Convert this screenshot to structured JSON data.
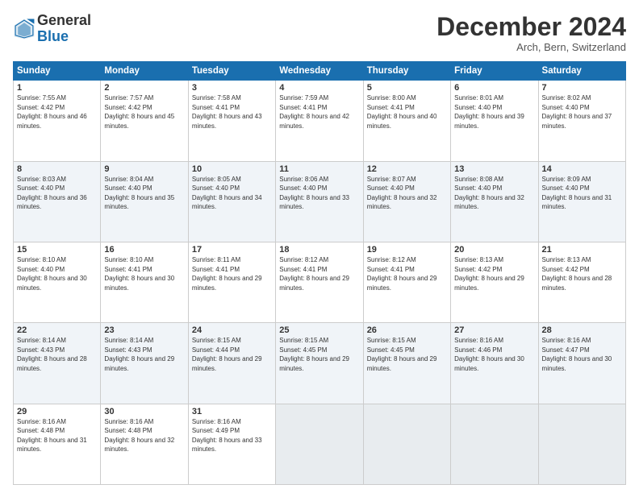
{
  "header": {
    "logo_general": "General",
    "logo_blue": "Blue",
    "month_title": "December 2024",
    "subtitle": "Arch, Bern, Switzerland"
  },
  "days_of_week": [
    "Sunday",
    "Monday",
    "Tuesday",
    "Wednesday",
    "Thursday",
    "Friday",
    "Saturday"
  ],
  "weeks": [
    [
      {
        "day": "1",
        "sunrise": "Sunrise: 7:55 AM",
        "sunset": "Sunset: 4:42 PM",
        "daylight": "Daylight: 8 hours and 46 minutes."
      },
      {
        "day": "2",
        "sunrise": "Sunrise: 7:57 AM",
        "sunset": "Sunset: 4:42 PM",
        "daylight": "Daylight: 8 hours and 45 minutes."
      },
      {
        "day": "3",
        "sunrise": "Sunrise: 7:58 AM",
        "sunset": "Sunset: 4:41 PM",
        "daylight": "Daylight: 8 hours and 43 minutes."
      },
      {
        "day": "4",
        "sunrise": "Sunrise: 7:59 AM",
        "sunset": "Sunset: 4:41 PM",
        "daylight": "Daylight: 8 hours and 42 minutes."
      },
      {
        "day": "5",
        "sunrise": "Sunrise: 8:00 AM",
        "sunset": "Sunset: 4:41 PM",
        "daylight": "Daylight: 8 hours and 40 minutes."
      },
      {
        "day": "6",
        "sunrise": "Sunrise: 8:01 AM",
        "sunset": "Sunset: 4:40 PM",
        "daylight": "Daylight: 8 hours and 39 minutes."
      },
      {
        "day": "7",
        "sunrise": "Sunrise: 8:02 AM",
        "sunset": "Sunset: 4:40 PM",
        "daylight": "Daylight: 8 hours and 37 minutes."
      }
    ],
    [
      {
        "day": "8",
        "sunrise": "Sunrise: 8:03 AM",
        "sunset": "Sunset: 4:40 PM",
        "daylight": "Daylight: 8 hours and 36 minutes."
      },
      {
        "day": "9",
        "sunrise": "Sunrise: 8:04 AM",
        "sunset": "Sunset: 4:40 PM",
        "daylight": "Daylight: 8 hours and 35 minutes."
      },
      {
        "day": "10",
        "sunrise": "Sunrise: 8:05 AM",
        "sunset": "Sunset: 4:40 PM",
        "daylight": "Daylight: 8 hours and 34 minutes."
      },
      {
        "day": "11",
        "sunrise": "Sunrise: 8:06 AM",
        "sunset": "Sunset: 4:40 PM",
        "daylight": "Daylight: 8 hours and 33 minutes."
      },
      {
        "day": "12",
        "sunrise": "Sunrise: 8:07 AM",
        "sunset": "Sunset: 4:40 PM",
        "daylight": "Daylight: 8 hours and 32 minutes."
      },
      {
        "day": "13",
        "sunrise": "Sunrise: 8:08 AM",
        "sunset": "Sunset: 4:40 PM",
        "daylight": "Daylight: 8 hours and 32 minutes."
      },
      {
        "day": "14",
        "sunrise": "Sunrise: 8:09 AM",
        "sunset": "Sunset: 4:40 PM",
        "daylight": "Daylight: 8 hours and 31 minutes."
      }
    ],
    [
      {
        "day": "15",
        "sunrise": "Sunrise: 8:10 AM",
        "sunset": "Sunset: 4:40 PM",
        "daylight": "Daylight: 8 hours and 30 minutes."
      },
      {
        "day": "16",
        "sunrise": "Sunrise: 8:10 AM",
        "sunset": "Sunset: 4:41 PM",
        "daylight": "Daylight: 8 hours and 30 minutes."
      },
      {
        "day": "17",
        "sunrise": "Sunrise: 8:11 AM",
        "sunset": "Sunset: 4:41 PM",
        "daylight": "Daylight: 8 hours and 29 minutes."
      },
      {
        "day": "18",
        "sunrise": "Sunrise: 8:12 AM",
        "sunset": "Sunset: 4:41 PM",
        "daylight": "Daylight: 8 hours and 29 minutes."
      },
      {
        "day": "19",
        "sunrise": "Sunrise: 8:12 AM",
        "sunset": "Sunset: 4:41 PM",
        "daylight": "Daylight: 8 hours and 29 minutes."
      },
      {
        "day": "20",
        "sunrise": "Sunrise: 8:13 AM",
        "sunset": "Sunset: 4:42 PM",
        "daylight": "Daylight: 8 hours and 29 minutes."
      },
      {
        "day": "21",
        "sunrise": "Sunrise: 8:13 AM",
        "sunset": "Sunset: 4:42 PM",
        "daylight": "Daylight: 8 hours and 28 minutes."
      }
    ],
    [
      {
        "day": "22",
        "sunrise": "Sunrise: 8:14 AM",
        "sunset": "Sunset: 4:43 PM",
        "daylight": "Daylight: 8 hours and 28 minutes."
      },
      {
        "day": "23",
        "sunrise": "Sunrise: 8:14 AM",
        "sunset": "Sunset: 4:43 PM",
        "daylight": "Daylight: 8 hours and 29 minutes."
      },
      {
        "day": "24",
        "sunrise": "Sunrise: 8:15 AM",
        "sunset": "Sunset: 4:44 PM",
        "daylight": "Daylight: 8 hours and 29 minutes."
      },
      {
        "day": "25",
        "sunrise": "Sunrise: 8:15 AM",
        "sunset": "Sunset: 4:45 PM",
        "daylight": "Daylight: 8 hours and 29 minutes."
      },
      {
        "day": "26",
        "sunrise": "Sunrise: 8:15 AM",
        "sunset": "Sunset: 4:45 PM",
        "daylight": "Daylight: 8 hours and 29 minutes."
      },
      {
        "day": "27",
        "sunrise": "Sunrise: 8:16 AM",
        "sunset": "Sunset: 4:46 PM",
        "daylight": "Daylight: 8 hours and 30 minutes."
      },
      {
        "day": "28",
        "sunrise": "Sunrise: 8:16 AM",
        "sunset": "Sunset: 4:47 PM",
        "daylight": "Daylight: 8 hours and 30 minutes."
      }
    ],
    [
      {
        "day": "29",
        "sunrise": "Sunrise: 8:16 AM",
        "sunset": "Sunset: 4:48 PM",
        "daylight": "Daylight: 8 hours and 31 minutes."
      },
      {
        "day": "30",
        "sunrise": "Sunrise: 8:16 AM",
        "sunset": "Sunset: 4:48 PM",
        "daylight": "Daylight: 8 hours and 32 minutes."
      },
      {
        "day": "31",
        "sunrise": "Sunrise: 8:16 AM",
        "sunset": "Sunset: 4:49 PM",
        "daylight": "Daylight: 8 hours and 33 minutes."
      },
      null,
      null,
      null,
      null
    ]
  ]
}
